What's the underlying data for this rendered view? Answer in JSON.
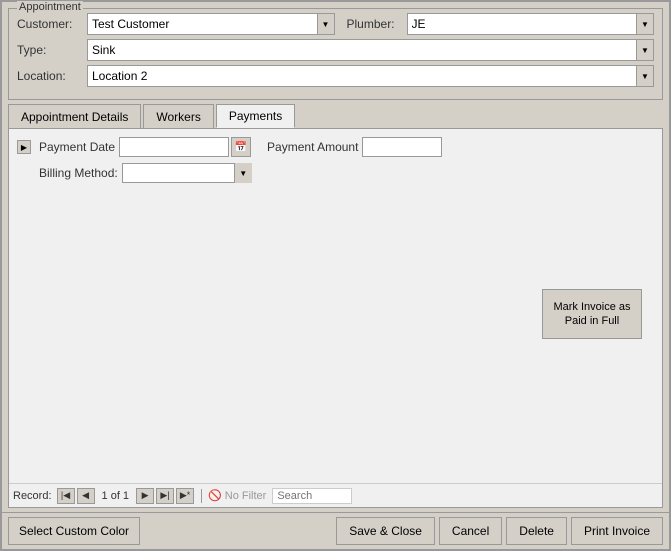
{
  "window": {
    "title": "Appointment"
  },
  "appointment": {
    "group_label": "Appointment",
    "customer_label": "Customer:",
    "customer_value": "Test Customer",
    "plumber_label": "Plumber:",
    "plumber_value": "JE",
    "type_label": "Type:",
    "type_value": "Sink",
    "location_label": "Location:",
    "location_value": "Location 2"
  },
  "tabs": [
    {
      "id": "appointment-details",
      "label": "Appointment Details",
      "active": false
    },
    {
      "id": "workers",
      "label": "Workers",
      "active": false
    },
    {
      "id": "payments",
      "label": "Payments",
      "active": true
    }
  ],
  "payments": {
    "payment_date_label": "Payment Date",
    "payment_date_value": "",
    "payment_amount_label": "Payment Amount",
    "payment_amount_value": "",
    "billing_method_label": "Billing Method:",
    "billing_method_value": "",
    "mark_invoice_label": "Mark Invoice as Paid in Full"
  },
  "record_nav": {
    "record_text": "1 of 1",
    "no_filter_label": "No Filter",
    "search_placeholder": "Search"
  },
  "toolbar": {
    "select_color_label": "Select Custom Color",
    "save_close_label": "Save & Close",
    "cancel_label": "Cancel",
    "delete_label": "Delete",
    "print_invoice_label": "Print Invoice"
  },
  "icons": {
    "dropdown_arrow": "▼",
    "calendar": "📅",
    "nav_first": "⏮",
    "nav_prev": "◀",
    "nav_next": "▶",
    "nav_last": "⏭",
    "nav_new": "▶*",
    "record_arrow": "▶",
    "no_filter_icon": "🚫"
  }
}
